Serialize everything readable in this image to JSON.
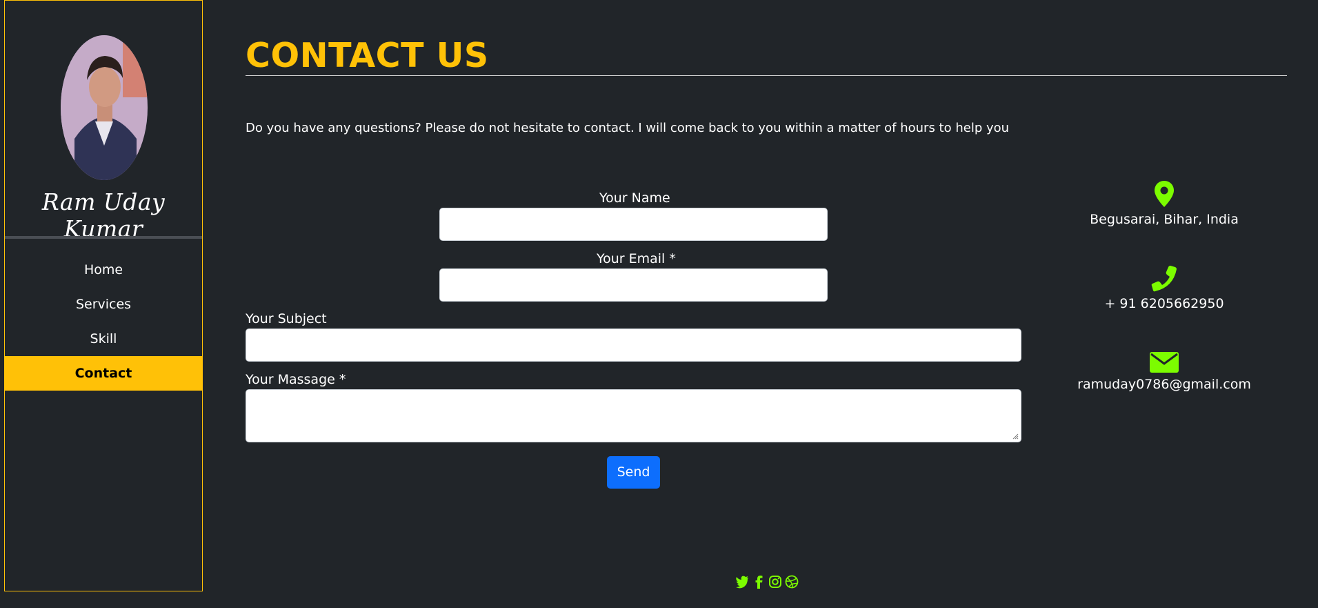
{
  "sidebar": {
    "name": "Ram Uday Kumar",
    "nav": [
      {
        "label": "Home"
      },
      {
        "label": "Services"
      },
      {
        "label": "Skill"
      },
      {
        "label": "Contact",
        "active": true
      }
    ]
  },
  "main": {
    "title": "CONTACT US",
    "intro": "Do you have any questions? Please do not hesitate to contact. I will come back to you within a matter of hours to help you"
  },
  "form": {
    "name_label": "Your Name",
    "email_label": "Your Email *",
    "subject_label": "Your Subject",
    "message_label": "Your Massage *",
    "send_label": "Send"
  },
  "contact_info": {
    "address": "Begusarai, Bihar, India",
    "phone": "+ 91 6205662950",
    "email": "ramuday0786@gmail.com"
  },
  "social": [
    "twitter-icon",
    "facebook-icon",
    "instagram-icon",
    "dribbble-icon"
  ],
  "colors": {
    "background": "#212529",
    "accent": "#ffc107",
    "icon_green": "#7cfc00",
    "button": "#0d6efd"
  }
}
